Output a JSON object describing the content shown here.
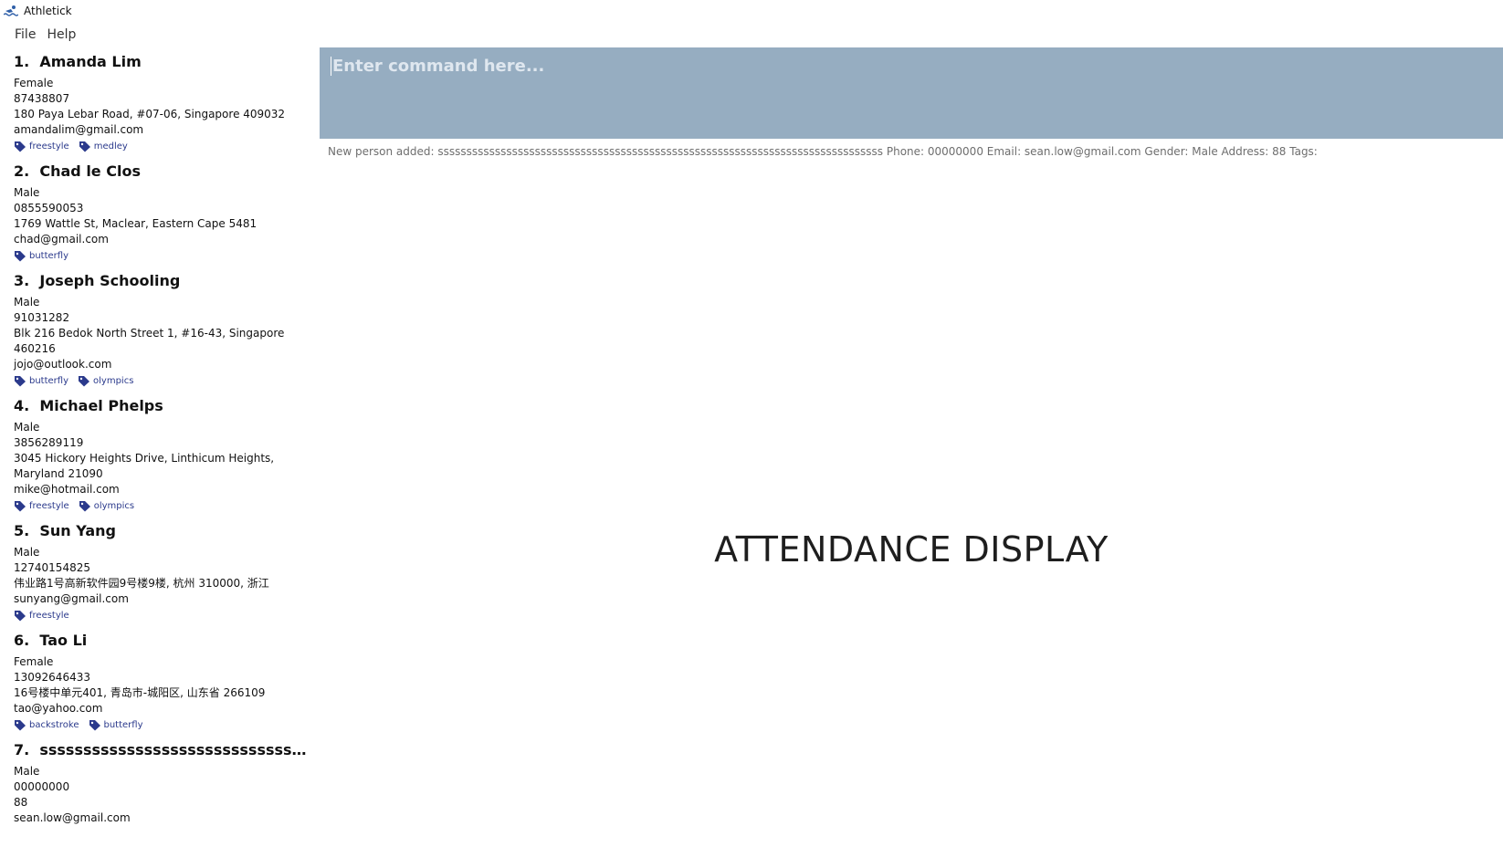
{
  "window": {
    "title": "Athletick",
    "icon": "swimmer-icon"
  },
  "menu": {
    "items": [
      "File",
      "Help"
    ]
  },
  "persons": [
    {
      "index": "1.",
      "name": "Amanda Lim",
      "gender": "Female",
      "phone": "87438807",
      "address": "180 Paya Lebar Road, #07-06, Singapore 409032",
      "email": "amandalim@gmail.com",
      "tags": [
        "freestyle",
        "medley"
      ]
    },
    {
      "index": "2.",
      "name": "Chad le Clos",
      "gender": "Male",
      "phone": "0855590053",
      "address": "1769 Wattle St, Maclear, Eastern Cape 5481",
      "email": "chad@gmail.com",
      "tags": [
        "butterfly"
      ]
    },
    {
      "index": "3.",
      "name": "Joseph Schooling",
      "gender": "Male",
      "phone": "91031282",
      "address": "Blk 216 Bedok North Street 1, #16-43, Singapore 460216",
      "email": "jojo@outlook.com",
      "tags": [
        "butterfly",
        "olympics"
      ]
    },
    {
      "index": "4.",
      "name": "Michael Phelps",
      "gender": "Male",
      "phone": "3856289119",
      "address": "3045 Hickory Heights Drive, Linthicum Heights, Maryland 21090",
      "email": "mike@hotmail.com",
      "tags": [
        "freestyle",
        "olympics"
      ]
    },
    {
      "index": "5.",
      "name": "Sun Yang",
      "gender": "Male",
      "phone": "12740154825",
      "address": "伟业路1号高新软件园9号楼9楼, 杭州 310000, 浙江",
      "email": "sunyang@gmail.com",
      "tags": [
        "freestyle"
      ]
    },
    {
      "index": "6.",
      "name": "Tao Li",
      "gender": "Female",
      "phone": "13092646433",
      "address": "16号楼中单元401, 青岛市-城阳区, 山东省 266109",
      "email": "tao@yahoo.com",
      "tags": [
        "backstroke",
        "butterfly"
      ]
    },
    {
      "index": "7.",
      "name": "sssssssssssssssssssssssssssssssssssssssssss...",
      "gender": "Male",
      "phone": "00000000",
      "address": "88",
      "email": "sean.low@gmail.com",
      "tags": []
    }
  ],
  "command": {
    "placeholder": "Enter command here...",
    "value": ""
  },
  "result": {
    "text": "New person added: ssssssssssssssssssssssssssssssssssssssssssssssssssssssssssssssssssssssssssssss Phone: 00000000 Email: sean.low@gmail.com Gender: Male Address: 88 Tags:"
  },
  "main": {
    "attendance_label": "ATTENDANCE DISPLAY"
  }
}
